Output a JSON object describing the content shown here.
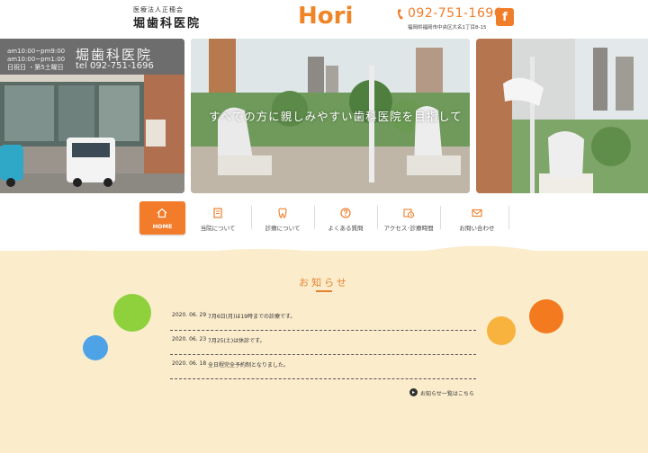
{
  "header": {
    "org_sub": "医療法人正穂会",
    "org_name": "堀歯科医院",
    "logo": "Hori",
    "tel": "092-751-1696",
    "address": "福岡県福岡市中央区大名1丁目8-15",
    "facebook_label": "f"
  },
  "hero": {
    "sign_hours_line1": "am10:00~pm9:00",
    "sign_hours_line2": "am10:00~pm1:00",
    "sign_days": "日祝日 ・第5土曜日",
    "sign_name": "堀歯科医院",
    "sign_tel": "tel 092-751-1696",
    "catchphrase": "すべての方に親しみやすい歯科医院を目指して"
  },
  "nav": {
    "items": [
      {
        "label": "HOME",
        "icon": "home-icon"
      },
      {
        "label": "当院について",
        "icon": "clinic-icon"
      },
      {
        "label": "診療について",
        "icon": "tooth-icon"
      },
      {
        "label": "よくある質問",
        "icon": "question-icon"
      },
      {
        "label": "アクセス･診療時間",
        "icon": "calendar-clock-icon"
      },
      {
        "label": "お問い合わせ",
        "icon": "mail-icon"
      }
    ]
  },
  "news": {
    "title": "お知らせ",
    "items": [
      {
        "date": "2020. 06. 29",
        "text": "7月6日(月)は19時までの診療です。"
      },
      {
        "date": "2020. 06. 23",
        "text": "7月25(土)は休診です。"
      },
      {
        "date": "2020. 06. 18",
        "text": "全日程完全予約制となりました。"
      }
    ],
    "more_label": "お知らせ一覧はこちら"
  },
  "colors": {
    "accent": "#f27c2a",
    "news_bg": "#fbeccc"
  }
}
